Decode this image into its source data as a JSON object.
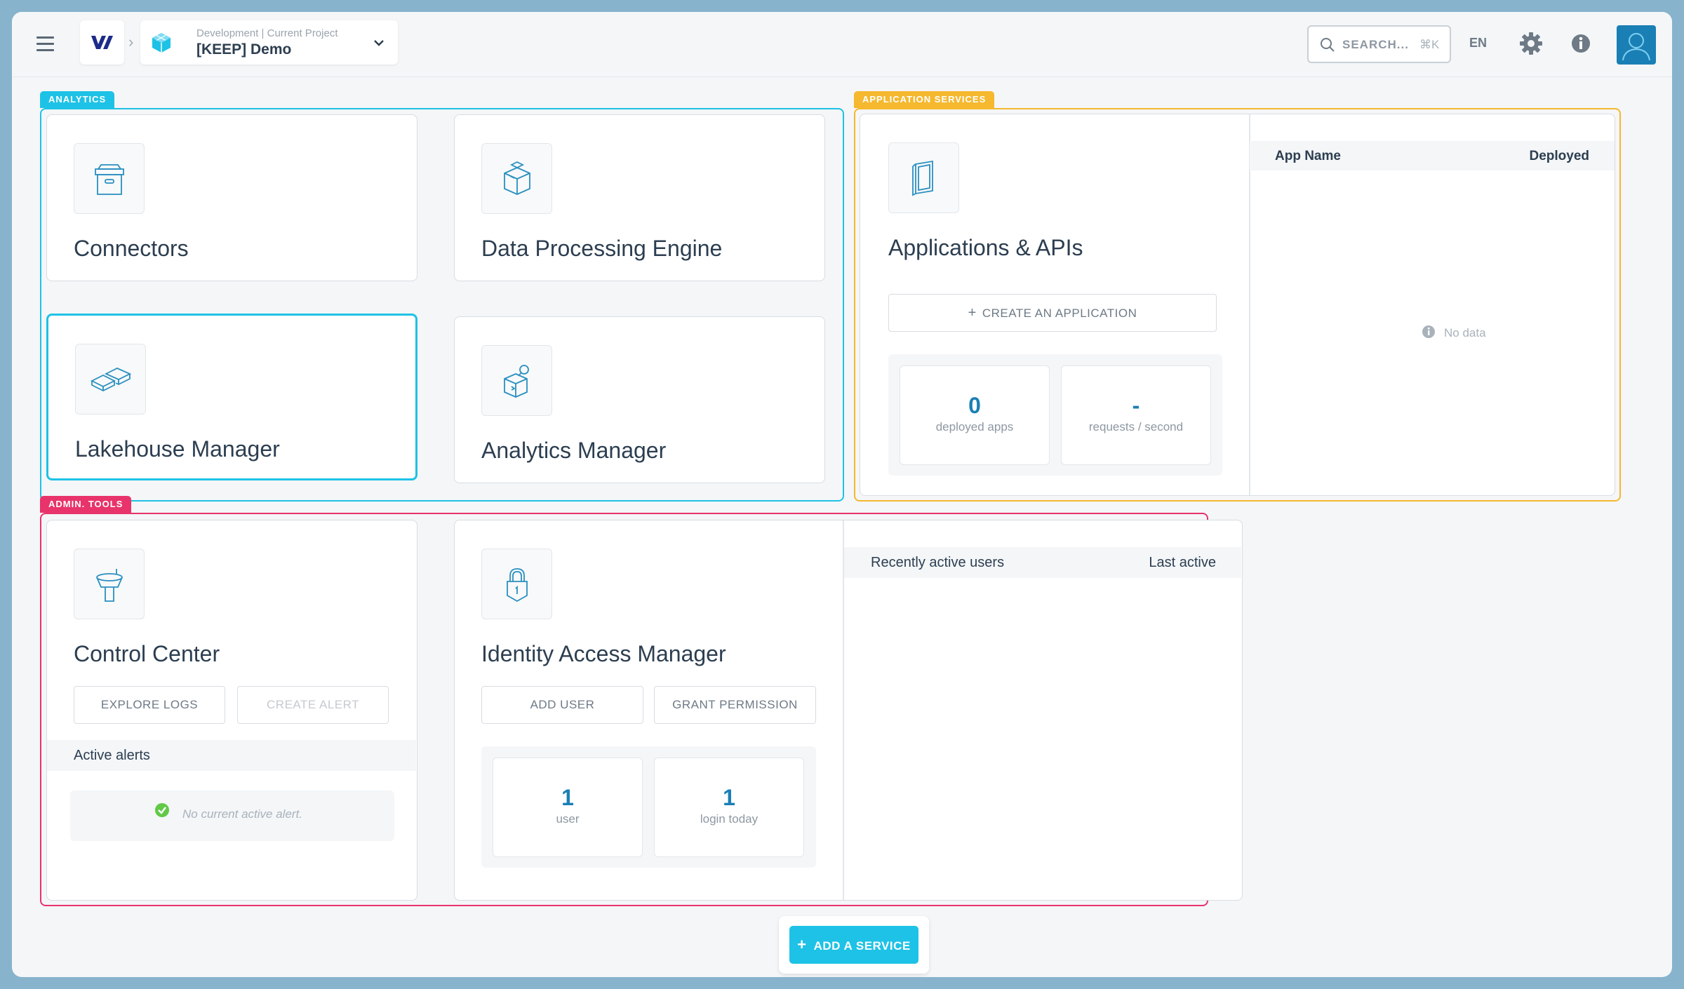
{
  "header": {
    "project_sub_left": "Development",
    "project_sub_right": "Current Project",
    "project_name": "[KEEP] Demo",
    "search_label": "SEARCH...",
    "search_shortcut": "⌘K",
    "language": "EN"
  },
  "analytics": {
    "tag": "ANALYTICS",
    "cards": [
      {
        "title": "Connectors",
        "icon": "archive-box-icon"
      },
      {
        "title": "Data Processing Engine",
        "icon": "cube-icon"
      },
      {
        "title": "Lakehouse Manager",
        "icon": "blocks-icon"
      },
      {
        "title": "Analytics Manager",
        "icon": "cube-search-icon"
      }
    ]
  },
  "app_services": {
    "tag": "APPLICATION SERVICES",
    "title": "Applications & APIs",
    "create_button": "CREATE AN APPLICATION",
    "stats": [
      {
        "value": "0",
        "label": "deployed apps"
      },
      {
        "value": "-",
        "label": "requests / second"
      }
    ],
    "table_headers": [
      "App Name",
      "Deployed"
    ],
    "empty_text": "No data"
  },
  "admin": {
    "tag": "ADMIN. TOOLS",
    "control_center": {
      "title": "Control Center",
      "explore_button": "EXPLORE LOGS",
      "alert_button": "CREATE ALERT",
      "alerts_header": "Active alerts",
      "no_alert_text": "No current active alert."
    },
    "iam": {
      "title": "Identity Access Manager",
      "add_user_button": "ADD USER",
      "grant_button": "GRANT PERMISSION",
      "stats": [
        {
          "value": "1",
          "label": "user"
        },
        {
          "value": "1",
          "label": "login today"
        }
      ],
      "table_headers": [
        "Recently active users",
        "Last active"
      ]
    }
  },
  "add_service_button": "ADD A SERVICE",
  "colors": {
    "analytics": "#1ec2e6",
    "app_services": "#f5b82e",
    "admin": "#e8336b",
    "value": "#1a7fb5"
  }
}
